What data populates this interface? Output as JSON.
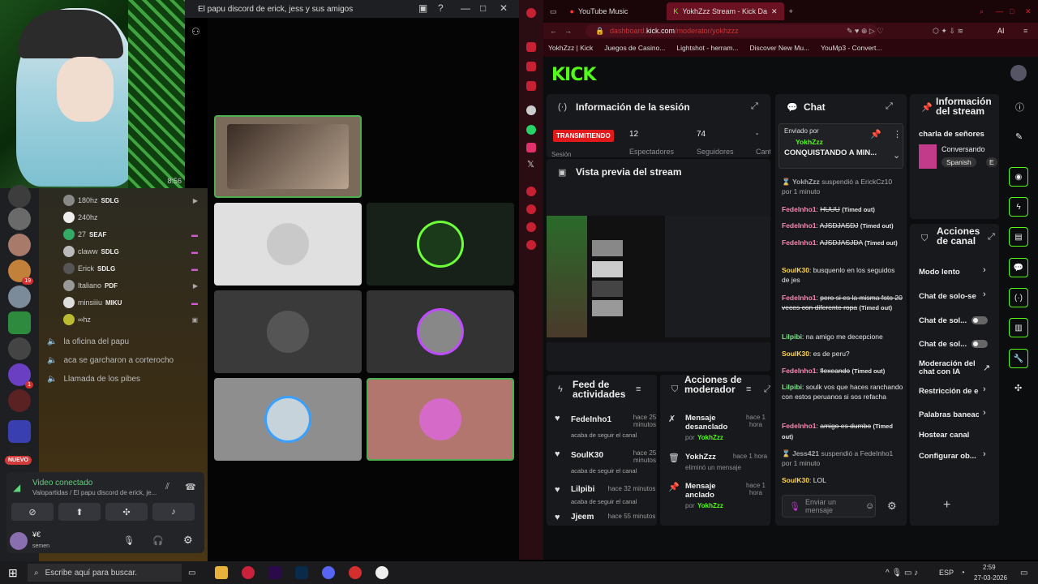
{
  "discord": {
    "window_title": "El papu discord de erick, jess y sus amigos",
    "art_timer": "8:56",
    "voice_users": [
      {
        "name": "180hz",
        "tag": "SDLG"
      },
      {
        "name": "240hz",
        "tag": ""
      },
      {
        "name": "27",
        "tag": "SEAF"
      },
      {
        "name": "claww",
        "tag": "SDLG"
      },
      {
        "name": "Erick",
        "tag": "SDLG"
      },
      {
        "name": "Italiano",
        "tag": "PDF"
      },
      {
        "name": "minsiiiu",
        "tag": "MIKU"
      },
      {
        "name": "∞hz",
        "tag": ""
      }
    ],
    "voice_channels": [
      "la oficina del papu",
      "aca se garcharon a corterocho",
      "Llamada de los pibes"
    ],
    "new_badge": "NUEVO",
    "server_badges": [
      "19",
      "1"
    ],
    "voice_panel": {
      "status": "Video conectado",
      "subtitle": "Valopartidas / El papu discord de erick, je...",
      "user_name": "¥€",
      "user_status": "semen"
    }
  },
  "browser": {
    "tabs": [
      {
        "label": "YouTube Music",
        "active": false
      },
      {
        "label": "YokhZzz Stream - Kick Da",
        "active": true
      }
    ],
    "url_prefix": "dashboard.",
    "url_domain": "kick.com",
    "url_path": "/moderator/yokhzzz",
    "bookmarks": [
      "YokhZzz | Kick",
      "Juegos de Casino...",
      "Lightshot - herram...",
      "Discover New Mu...",
      "YouMp3 - Convert..."
    ]
  },
  "kick": {
    "logo": "KICK",
    "session_info": {
      "title": "Información de la sesión",
      "live_badge": "TRANSMITIENDO",
      "stats": [
        {
          "value": "12",
          "label": "Espectadores"
        },
        {
          "value": "74",
          "label": "Seguidores"
        },
        {
          "value": "-",
          "label": "Cant"
        }
      ],
      "session_label": "Sesión"
    },
    "preview_title": "Vista previa del stream",
    "feed": {
      "title": "Feed de actividades",
      "items": [
        {
          "name": "FedeInho1",
          "time": "hace 25 minutos",
          "desc": "acaba de seguir el canal"
        },
        {
          "name": "SoulK30",
          "time": "hace 25 minutos",
          "desc": "acaba de seguir el canal"
        },
        {
          "name": "Lilpibi",
          "time": "hace 32 minutos",
          "desc": "acaba de seguir el canal"
        },
        {
          "name": "Jjeem",
          "time": "hace 55 minutos",
          "desc": ""
        }
      ]
    },
    "mod_actions": {
      "title": "Acciones de moderador",
      "items": [
        {
          "action": "Mensaje desanclado",
          "by": "YokhZzz",
          "time": "hace 1 hora"
        },
        {
          "action": "YokhZzz",
          "by": "eliminó un mensaje",
          "time": "hace 1 hora"
        },
        {
          "action": "Mensaje anclado",
          "by": "YokhZzz",
          "time": "hace 1 hora"
        }
      ],
      "by_label": "por"
    },
    "chat": {
      "title": "Chat",
      "pinned_label": "Enviado por",
      "pinned_user": "YokhZzz",
      "pinned_text": "CONQUISTANDO A MIN...",
      "messages": [
        {
          "user": "YokhZzz",
          "text": "suspendió a ErickCz10 por 1 minuto",
          "type": "system"
        },
        {
          "user": "FedeInho1",
          "text": "HUUU",
          "note": "(Timed out)",
          "deleted": true
        },
        {
          "user": "FedeInho1",
          "text": "AJSDJASDJ",
          "note": "(Timed out)",
          "deleted": true
        },
        {
          "user": "FedeInho1",
          "text": "AJSDJASJDA",
          "note": "(Timed out)",
          "deleted": true
        },
        {
          "user": "SoulK30",
          "text": "busquenlo en los seguidos de jes",
          "deleted": false
        },
        {
          "user": "FedeInho1",
          "text": "pero si es la misma foto 20 veces con diferente ropa",
          "note": "(Timed out)",
          "deleted": true
        },
        {
          "user": "Lilpibi",
          "text": "na amigo me decepcione",
          "deleted": false
        },
        {
          "user": "SoulK30",
          "text": "es de peru?",
          "deleted": false
        },
        {
          "user": "FedeInho1",
          "text": "flexeando",
          "note": "(Timed out)",
          "deleted": true
        },
        {
          "user": "Lilpibi",
          "text": "soulk vos que haces ranchando con estos peruanos si sos refacha",
          "deleted": false
        },
        {
          "user": "FedeInho1",
          "text": "amigo es dumbo",
          "note": "(Timed out)",
          "deleted": true
        },
        {
          "user": "Jess421",
          "text": "suspendió a FedeInho1 por 1 minuto",
          "type": "system"
        },
        {
          "user": "SoulK30",
          "text": "LOL",
          "deleted": false
        }
      ],
      "input_placeholder": "Enviar un mensaje"
    },
    "stream_info": {
      "title": "Información del stream",
      "stream_title": "charla de señores",
      "category": "Conversando",
      "language": "Spanish",
      "extra": "E"
    },
    "channel_actions": {
      "title": "Acciones de canal",
      "items": [
        "Modo lento",
        "Chat de solo-se",
        "Chat de sol...",
        "Chat de sol...",
        "Moderación del chat con IA",
        "Restricción de e",
        "Palabras baneac",
        "Hostear canal",
        "Configurar ob..."
      ]
    }
  },
  "taskbar": {
    "search_placeholder": "Escribe aquí para buscar.",
    "lang": "ESP",
    "time": "2:59",
    "date": "27-03-2026"
  }
}
